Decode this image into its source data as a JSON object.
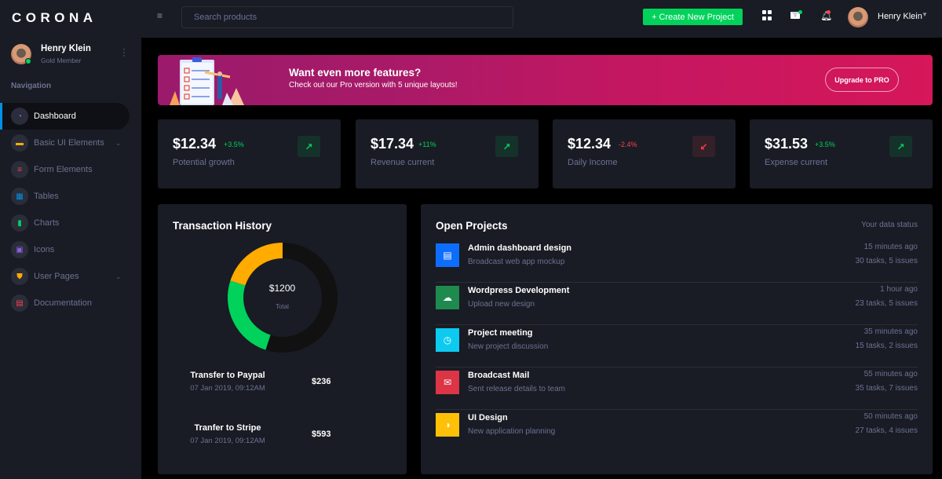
{
  "brand": "CORONA",
  "profile": {
    "name": "Henry Klein",
    "role": "Gold Member"
  },
  "nav_heading": "Navigation",
  "sidebar": {
    "items": [
      {
        "label": "Dashboard",
        "icon": "speedometer-icon",
        "color": "#8f5fe8",
        "active": true,
        "has_submenu": false
      },
      {
        "label": "Basic UI Elements",
        "icon": "laptop-icon",
        "color": "#ffab00",
        "active": false,
        "has_submenu": true
      },
      {
        "label": "Form Elements",
        "icon": "playlist-play-icon",
        "color": "#fc424a",
        "active": false,
        "has_submenu": false
      },
      {
        "label": "Tables",
        "icon": "table-icon",
        "color": "#0090e7",
        "active": false,
        "has_submenu": false
      },
      {
        "label": "Charts",
        "icon": "chart-bar-icon",
        "color": "#00d25b",
        "active": false,
        "has_submenu": false
      },
      {
        "label": "Icons",
        "icon": "contacts-icon",
        "color": "#8f5fe8",
        "active": false,
        "has_submenu": false
      },
      {
        "label": "User Pages",
        "icon": "security-icon",
        "color": "#ffab00",
        "active": false,
        "has_submenu": true
      },
      {
        "label": "Documentation",
        "icon": "file-document-icon",
        "color": "#fc424a",
        "active": false,
        "has_submenu": false
      }
    ]
  },
  "navbar": {
    "search_placeholder": "Search products",
    "create_label": "+ Create New Project",
    "user_name": "Henry Klein"
  },
  "banner": {
    "title": "Want even more features?",
    "subtitle": "Check out our Pro version with 5 unique layouts!",
    "button_label": "Upgrade to PRO"
  },
  "stats": [
    {
      "value": "$12.34",
      "change": "+3.5%",
      "trend": "up",
      "label": "Potential growth"
    },
    {
      "value": "$17.34",
      "change": "+11%",
      "trend": "up",
      "label": "Revenue current"
    },
    {
      "value": "$12.34",
      "change": "-2.4%",
      "trend": "down",
      "label": "Daily Income"
    },
    {
      "value": "$31.53",
      "change": "+3.5%",
      "trend": "up",
      "label": "Expense current"
    }
  ],
  "transactions": {
    "title": "Transaction History",
    "total_value": "$1200",
    "total_label": "Total",
    "items": [
      {
        "name": "Transfer to Paypal",
        "date": "07 Jan 2019, 09:12AM",
        "amount": "$236"
      },
      {
        "name": "Tranfer to Stripe",
        "date": "07 Jan 2019, 09:12AM",
        "amount": "$593"
      }
    ]
  },
  "chart_data": {
    "type": "pie",
    "title": "Transaction History",
    "center_label": "$1200 Total",
    "series": [
      {
        "name": "segment-1",
        "value": 55,
        "color": "#111111"
      },
      {
        "name": "segment-2",
        "value": 25,
        "color": "#00d25b"
      },
      {
        "name": "segment-3",
        "value": 20,
        "color": "#ffab00"
      }
    ]
  },
  "projects": {
    "title": "Open Projects",
    "status_label": "Your data status",
    "items": [
      {
        "title": "Admin dashboard design",
        "subtitle": "Broadcast web app mockup",
        "time": "15 minutes ago",
        "tasks": "30 tasks, 5 issues",
        "icon": "file-document-icon",
        "color": "#0d6efd"
      },
      {
        "title": "Wordpress Development",
        "subtitle": "Upload new design",
        "time": "1 hour ago",
        "tasks": "23 tasks, 5 issues",
        "icon": "cloud-download-icon",
        "color": "#1e8a4e"
      },
      {
        "title": "Project meeting",
        "subtitle": "New project discussion",
        "time": "35 minutes ago",
        "tasks": "15 tasks, 2 issues",
        "icon": "clock-icon",
        "color": "#0dcaf0"
      },
      {
        "title": "Broadcast Mail",
        "subtitle": "Sent release details to team",
        "time": "55 minutes ago",
        "tasks": "35 tasks, 7 issues",
        "icon": "email-open-icon",
        "color": "#dc3545"
      },
      {
        "title": "UI Design",
        "subtitle": "New application planning",
        "time": "50 minutes ago",
        "tasks": "27 tasks, 4 issues",
        "icon": "chart-pie-icon",
        "color": "#ffc107"
      }
    ]
  }
}
